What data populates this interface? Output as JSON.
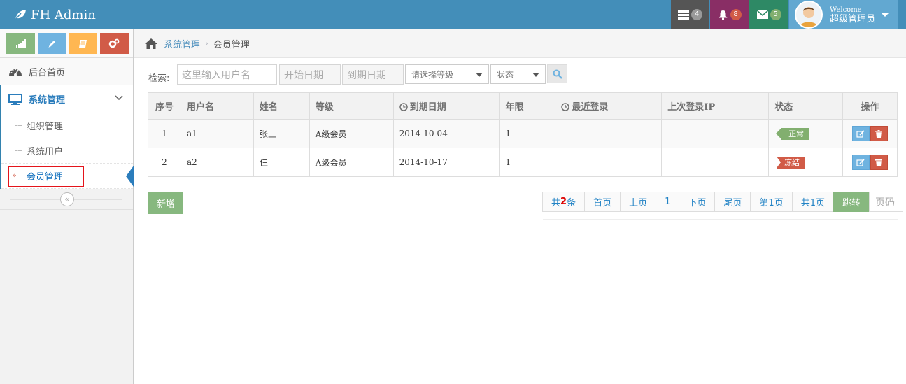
{
  "navbar": {
    "brand": "FH Admin",
    "tasks_count": "4",
    "notifications_count": "8",
    "messages_count": "5",
    "welcome": "Welcome",
    "username": "超级管理员",
    "colors": {
      "navbar": "#438eb9",
      "tasks": "#555555",
      "notifications": "#892e65",
      "messages": "#2e8965",
      "user": "#62a8d1"
    }
  },
  "sidebar": {
    "shortcuts": [
      "signal-icon",
      "pencil-icon",
      "book-icon",
      "cogs-icon"
    ],
    "home_label": "后台首页",
    "system_label": "系统管理",
    "sub_items": [
      {
        "label": "组织管理"
      },
      {
        "label": "系统用户"
      },
      {
        "label": "会员管理"
      }
    ]
  },
  "breadcrumb": {
    "parent": "系统管理",
    "current": "会员管理"
  },
  "search": {
    "label": "检索:",
    "username_placeholder": "这里输入用户名",
    "start_date_placeholder": "开始日期",
    "end_date_placeholder": "到期日期",
    "level_select": "请选择等级",
    "status_select": "状态"
  },
  "table": {
    "headers": {
      "index": "序号",
      "username": "用户名",
      "name": "姓名",
      "level": "等级",
      "expire": "到期日期",
      "years": "年限",
      "last_login": "最近登录",
      "last_ip": "上次登录IP",
      "status": "状态",
      "actions": "操作"
    },
    "rows": [
      {
        "index": "1",
        "username": "a1",
        "name": "张三",
        "level": "A级会员",
        "expire": "2014-10-04",
        "years": "1",
        "last_login": "",
        "last_ip": "",
        "status": "正常"
      },
      {
        "index": "2",
        "username": "a2",
        "name": "仨",
        "level": "A级会员",
        "expire": "2014-10-17",
        "years": "1",
        "last_login": "",
        "last_ip": "",
        "status": "冻结"
      }
    ]
  },
  "footer": {
    "add_label": "新增",
    "pager": {
      "total_prefix": "共",
      "total_count": "2",
      "total_suffix": "条",
      "first": "首页",
      "prev": "上页",
      "current": "1",
      "next": "下页",
      "last": "尾页",
      "page_of": "第1页",
      "pages": "共1页",
      "go": "跳转",
      "page_input_placeholder": "页码"
    }
  }
}
